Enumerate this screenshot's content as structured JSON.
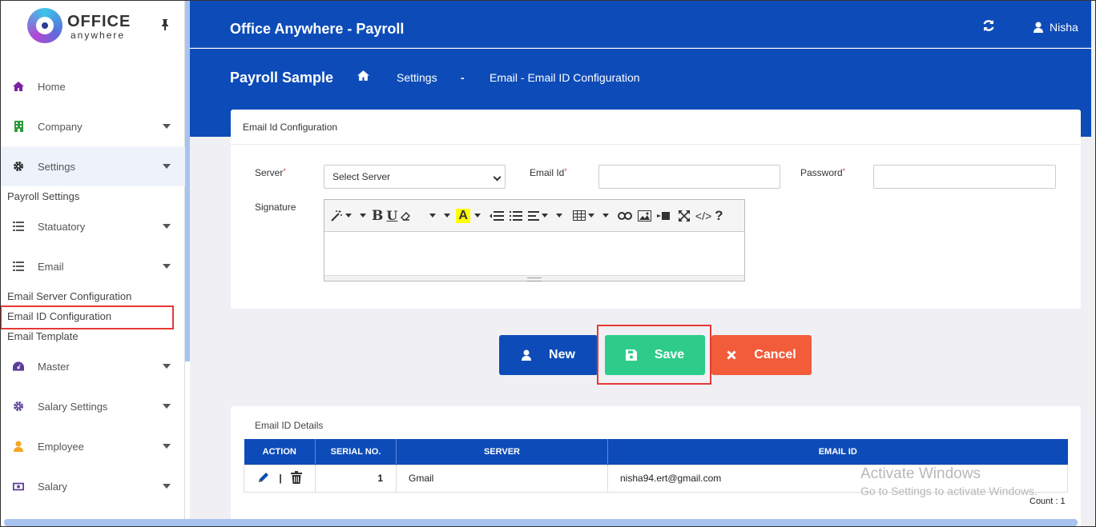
{
  "logo": {
    "line1": "OFFICE",
    "line2": "anywhere"
  },
  "sidebar": {
    "items": [
      {
        "label": "Home",
        "icon": "home-icon"
      },
      {
        "label": "Company",
        "icon": "building-icon"
      },
      {
        "label": "Settings",
        "icon": "gear-icon"
      },
      {
        "label": "Statuatory",
        "icon": "list-icon"
      },
      {
        "label": "Email",
        "icon": "list-icon"
      },
      {
        "label": "Master",
        "icon": "dashboard-icon"
      },
      {
        "label": "Salary Settings",
        "icon": "gear-icon"
      },
      {
        "label": "Employee",
        "icon": "user-icon"
      },
      {
        "label": "Salary",
        "icon": "money-icon"
      }
    ],
    "subitems": {
      "payroll_settings": "Payroll Settings",
      "email_server": "Email Server Configuration",
      "email_id": "Email ID Configuration",
      "email_template": "Email Template"
    }
  },
  "header": {
    "title": "Office Anywhere - Payroll",
    "user": "Nisha"
  },
  "breadcrumb": {
    "title": "Payroll Sample",
    "settings": "Settings",
    "sep": "-",
    "page": "Email - Email ID Configuration"
  },
  "form": {
    "card_title": "Email Id Configuration",
    "server_label": "Server",
    "server_value": "Select Server",
    "email_label": "Email Id",
    "password_label": "Password",
    "signature_label": "Signature",
    "required_mark": "*"
  },
  "buttons": {
    "new": "New",
    "save": "Save",
    "cancel": "Cancel"
  },
  "details": {
    "title": "Email ID Details",
    "columns": [
      "ACTION",
      "SERIAL NO.",
      "SERVER",
      "EMAIL ID"
    ],
    "rows": [
      {
        "serial": "1",
        "server": "Gmail",
        "email": "nisha94.ert@gmail.com"
      }
    ],
    "action_sep": "|",
    "count": "Count : 1"
  },
  "watermark": {
    "line1": "Activate Windows",
    "line2": "Go to Settings to activate Windows."
  },
  "colors": {
    "primary": "#0d4cb8",
    "new": "#0d4cb8",
    "save": "#2ecc8a",
    "cancel": "#f25c3a",
    "highlight": "#e53935"
  }
}
